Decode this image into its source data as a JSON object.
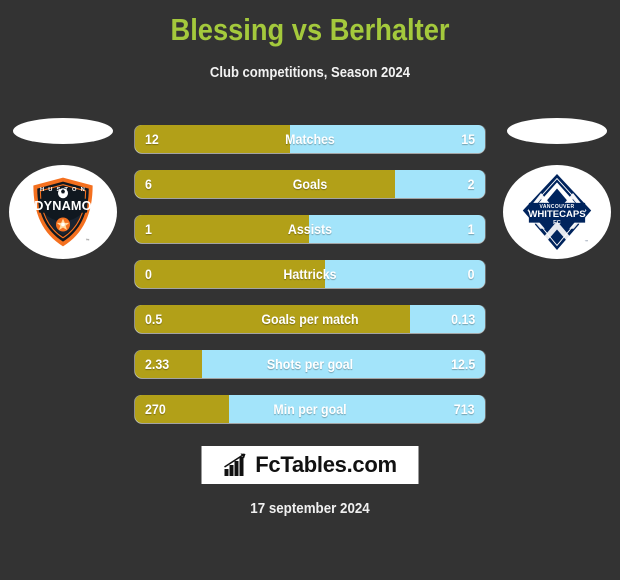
{
  "header": {
    "title": "Blessing vs Berhalter",
    "subtitle": "Club competitions, Season 2024",
    "title_color": "#a4c93c"
  },
  "teams": {
    "home": {
      "name": "Houston Dynamo",
      "badge_name": "houston-dynamo-logo",
      "badge_top_text": "HOUSTON",
      "badge_main_text": "DYNAMO",
      "colors": {
        "primary": "#101820",
        "accent": "#f4701f"
      }
    },
    "away": {
      "name": "Vancouver Whitecaps FC",
      "badge_name": "vancouver-whitecaps-logo",
      "badge_top_text": "VANCOUVER",
      "badge_main_text": "WHITECAPS",
      "badge_sub_text": "FC",
      "colors": {
        "primary": "#00245d",
        "accent": "#8ea5c8"
      }
    }
  },
  "colors": {
    "background": "#333333",
    "home_bar": "#b2a018",
    "away_bar": "#a3e4fa",
    "text": "#ffffff"
  },
  "chart_data": {
    "type": "bar",
    "title": "Blessing vs Berhalter",
    "subtitle": "Club competitions, Season 2024",
    "orientation": "horizontal-diverging",
    "series": [
      {
        "name": "Blessing",
        "team": "Houston Dynamo",
        "color": "#b2a018",
        "values": [
          "12",
          "6",
          "1",
          "0",
          "0.5",
          "2.33",
          "270"
        ]
      },
      {
        "name": "Berhalter",
        "team": "Vancouver Whitecaps FC",
        "color": "#a3e4fa",
        "values": [
          "15",
          "2",
          "1",
          "0",
          "0.13",
          "12.5",
          "713"
        ]
      }
    ],
    "categories": [
      "Matches",
      "Goals",
      "Assists",
      "Hattricks",
      "Goals per match",
      "Shots per goal",
      "Min per goal"
    ],
    "rows": [
      {
        "label": "Matches",
        "home": "12",
        "away": "15",
        "home_pct": 44.2
      },
      {
        "label": "Goals",
        "home": "6",
        "away": "2",
        "home_pct": 74.3
      },
      {
        "label": "Assists",
        "home": "1",
        "away": "1",
        "home_pct": 49.7
      },
      {
        "label": "Hattricks",
        "home": "0",
        "away": "0",
        "home_pct": 54.3
      },
      {
        "label": "Goals per match",
        "home": "0.5",
        "away": "0.13",
        "home_pct": 78.6
      },
      {
        "label": "Shots per goal",
        "home": "2.33",
        "away": "12.5",
        "home_pct": 19.0
      },
      {
        "label": "Min per goal",
        "home": "270",
        "away": "713",
        "home_pct": 26.9
      }
    ]
  },
  "footer": {
    "brand_text": "FcTables.com",
    "brand_icon": "bar-chart-icon",
    "date": "17 september 2024"
  }
}
